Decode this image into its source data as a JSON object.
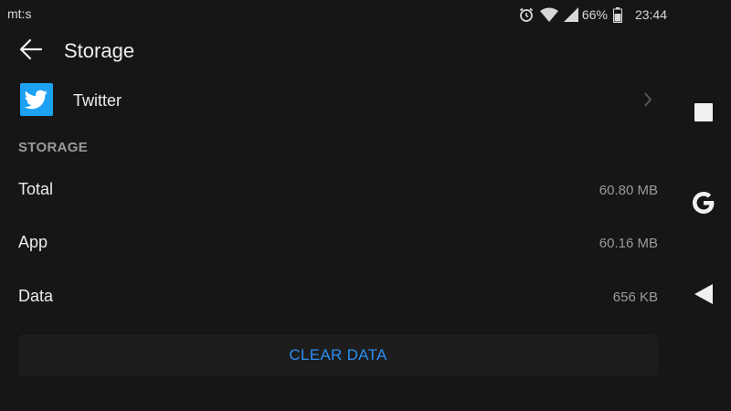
{
  "status_bar": {
    "carrier": "mt:s",
    "battery_percent": "66%",
    "time": "23:44",
    "icons": [
      "alarm-icon",
      "wifi-icon",
      "cell-signal-icon",
      "battery-icon"
    ]
  },
  "app_bar": {
    "title": "Storage",
    "back_icon": "arrow-left-icon"
  },
  "app_row": {
    "name": "Twitter",
    "icon": "twitter-bird-icon",
    "icon_color": "#1da1f2",
    "chevron_icon": "chevron-right-icon"
  },
  "storage_section": {
    "header": "STORAGE",
    "rows": [
      {
        "label": "Total",
        "value": "60.80 MB"
      },
      {
        "label": "App",
        "value": "60.16 MB"
      },
      {
        "label": "Data",
        "value": "656 KB"
      }
    ]
  },
  "actions": {
    "clear_data_label": "CLEAR DATA",
    "accent_color": "#2d8cf0"
  },
  "nav_bar": {
    "buttons": [
      "recents-square-icon",
      "google-g-icon",
      "back-triangle-icon"
    ]
  }
}
